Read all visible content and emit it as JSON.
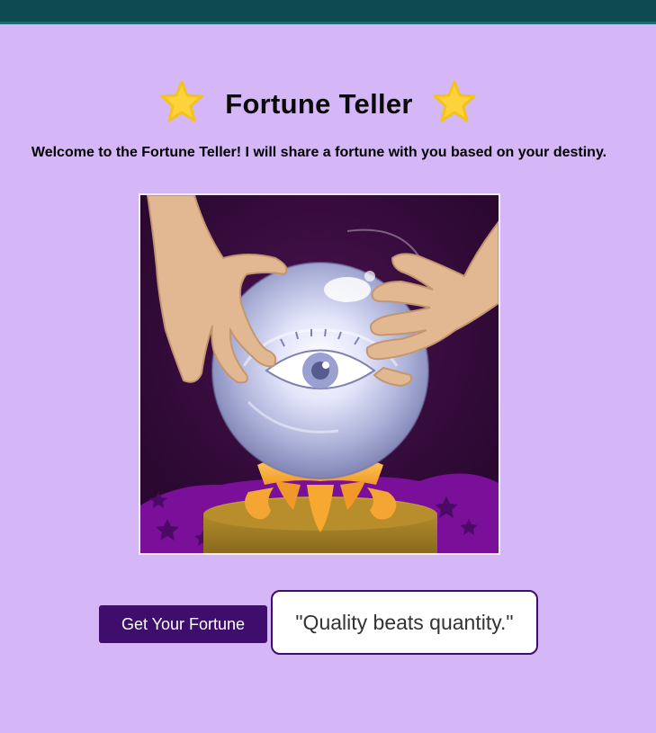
{
  "header": {
    "title": "Fortune Teller",
    "left_icon": "star-icon",
    "right_icon": "star-icon"
  },
  "intro": {
    "text": "Welcome to the Fortune Teller! I will share a fortune with you based on your destiny."
  },
  "illustration": {
    "subject": "crystal-ball-illustration"
  },
  "actions": {
    "get_fortune_label": "Get Your Fortune"
  },
  "fortune": {
    "text": "\"Quality beats quantity.\""
  },
  "colors": {
    "background": "#d5b6f7",
    "top_bar": "#0e4a52",
    "button": "#3f0d6b",
    "star": "#fdd23b"
  }
}
